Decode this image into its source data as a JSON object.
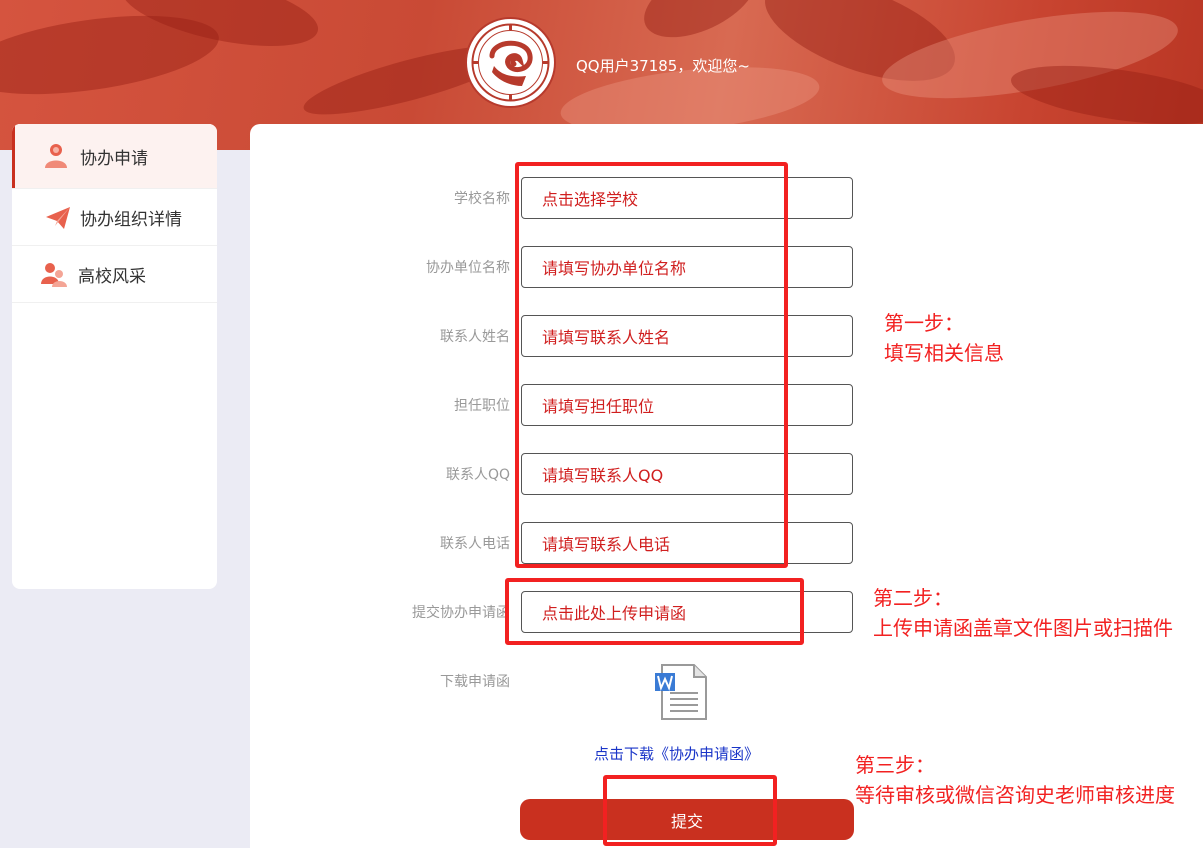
{
  "header": {
    "greeting": "QQ用户37185，欢迎您~"
  },
  "sidebar": {
    "items": [
      {
        "label": "协办申请",
        "icon": "person-icon",
        "active": true
      },
      {
        "label": "协办组织详情",
        "icon": "paper-plane-icon",
        "active": false
      },
      {
        "label": "高校风采",
        "icon": "people-icon",
        "active": false
      }
    ]
  },
  "form": {
    "fields": [
      {
        "label": "学校名称",
        "placeholder": "点击选择学校"
      },
      {
        "label": "协办单位名称",
        "placeholder": "请填写协办单位名称"
      },
      {
        "label": "联系人姓名",
        "placeholder": "请填写联系人姓名"
      },
      {
        "label": "担任职位",
        "placeholder": "请填写担任职位"
      },
      {
        "label": "联系人QQ",
        "placeholder": "请填写联系人QQ"
      },
      {
        "label": "联系人电话",
        "placeholder": "请填写联系人电话"
      },
      {
        "label": "提交协办申请函",
        "placeholder": "点击此处上传申请函"
      }
    ],
    "download_label": "下载申请函",
    "download_link": "点击下载《协办申请函》",
    "submit_label": "提交"
  },
  "annotations": {
    "step1_title": "第一步：",
    "step1_text": "填写相关信息",
    "step2_title": "第二步：",
    "step2_text": "上传申请函盖章文件图片或扫描件",
    "step3_title": "第三步：",
    "step3_text": "等待审核或微信咨询史老师审核进度"
  },
  "colors": {
    "brand": "#c9301f",
    "annotation": "#f22121",
    "field_text": "#d01f1f",
    "link": "#1a35c8"
  }
}
